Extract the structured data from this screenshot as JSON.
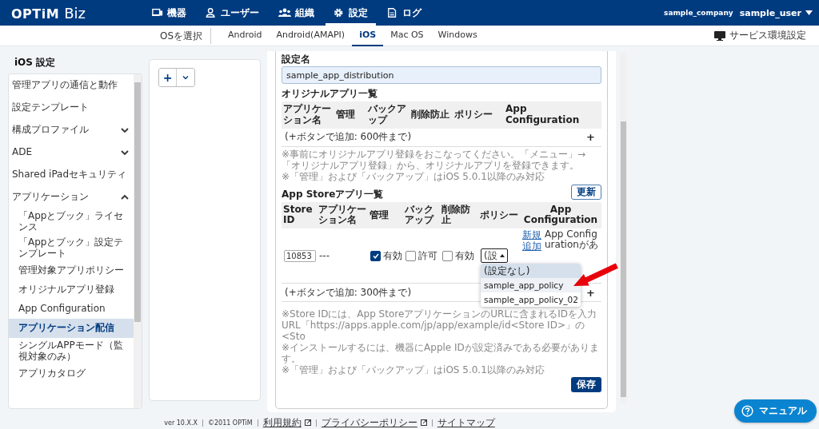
{
  "header": {
    "logo": "OPTiM",
    "logo_suffix": "Biz",
    "nav": [
      {
        "label": "機器",
        "kind": "device",
        "selected": false
      },
      {
        "label": "ユーザー",
        "kind": "user",
        "selected": false
      },
      {
        "label": "組織",
        "kind": "group",
        "selected": false
      },
      {
        "label": "設定",
        "kind": "gear",
        "selected": true
      },
      {
        "label": "ログ",
        "kind": "log",
        "selected": false
      }
    ],
    "company": "sample_company",
    "user": "sample_user"
  },
  "subnav": {
    "label": "OSを選択",
    "tabs": [
      {
        "label": "Android",
        "selected": false
      },
      {
        "label": "Android(AMAPI)",
        "selected": false
      },
      {
        "label": "iOS",
        "selected": true
      },
      {
        "label": "Mac OS",
        "selected": false
      },
      {
        "label": "Windows",
        "selected": false
      }
    ],
    "service_settings": "サービス環境設定"
  },
  "sidebar": {
    "title": "iOS 設定",
    "items": [
      {
        "label": "管理アプリの通信と動作",
        "selected": false
      },
      {
        "label": "設定テンプレート",
        "selected": false
      },
      {
        "label": "構成プロファイル",
        "selected": false,
        "expanded": false
      },
      {
        "label": "ADE",
        "selected": false,
        "expanded": false
      },
      {
        "label": "Shared iPadセキュリティ",
        "selected": false
      },
      {
        "label": "アプリケーション",
        "selected": false,
        "expanded": true,
        "children": [
          {
            "label": "「Appとブック」ライセンス",
            "selected": false
          },
          {
            "label": "「Appとブック」設定テンプレート",
            "selected": false
          },
          {
            "label": "管理対象アプリポリシー",
            "selected": false
          },
          {
            "label": "オリジナルアプリ登録",
            "selected": false
          },
          {
            "label": "App Configuration",
            "selected": false
          },
          {
            "label": "アプリケーション配信",
            "selected": true
          },
          {
            "label": "シングルAPPモード（監視対象のみ）",
            "selected": false
          },
          {
            "label": "アプリカタログ",
            "selected": false
          }
        ]
      }
    ]
  },
  "middle_panel": {
    "add_button": "+"
  },
  "form": {
    "name_label": "設定名",
    "name_value": "sample_app_distribution",
    "original_apps": {
      "title": "オリジナルアプリ一覧",
      "columns": [
        "アプリケーション名",
        "管理",
        "バックアップ",
        "削除防止",
        "ポリシー",
        "App Configuration"
      ],
      "add_hint": "(+ボタンで追加: 600件まで)",
      "add_button": "+",
      "notes": [
        "※事前にオリジナルアプリ登録をおこなってください。「メニュー」→「オリジナルアプリ登録」から、オリジナルアプリを登録できます。",
        "※「管理」および「バックアップ」はiOS 5.0.1以降のみ対応"
      ]
    },
    "app_store_apps": {
      "title": "App Storeアプリ一覧",
      "refresh_button": "更新",
      "columns": [
        "Store ID",
        "アプリケーション名",
        "管理",
        "バックアップ",
        "削除防止",
        "ポリシー",
        "App Configuration"
      ],
      "rows": [
        {
          "store_id": "10853",
          "app_name": "---",
          "manage": {
            "checked": true,
            "label": "有効"
          },
          "backup": {
            "checked": false,
            "label": "許可"
          },
          "protect": {
            "checked": false,
            "label": "有効"
          },
          "policy": "(設",
          "new_link": "新規追加",
          "app_config": "App Configurationがあ"
        }
      ],
      "add_hint": "(+ボタンで追加: 300件まで)",
      "add_button": "+",
      "notes": [
        "※Store IDには、App StoreアプリケーションのURLに含まれるIDを入力",
        "URL「https://apps.apple.com/jp/app/example/id<Store ID>」の<Sto",
        "※インストールするには、機器にApple IDが設定済みである必要があります。",
        "※「管理」および「バックアップ」はiOS 5.0.1以降のみ対応"
      ]
    },
    "save_button": "保存"
  },
  "policy_dropdown": {
    "options": [
      {
        "label": "(設定なし)",
        "selected": true,
        "hovered": false
      },
      {
        "label": "sample_app_policy",
        "selected": false,
        "hovered": true
      },
      {
        "label": "sample_app_policy_02",
        "selected": false,
        "hovered": false
      }
    ]
  },
  "footer": {
    "version": "ver 10.X.X",
    "copyright": "©2011 OPTiM",
    "links": [
      {
        "label": "利用規約",
        "external": true
      },
      {
        "label": "プライバシーポリシー",
        "external": true
      },
      {
        "label": "サイトマップ",
        "external": false
      }
    ]
  },
  "manual_button": "マニュアル"
}
